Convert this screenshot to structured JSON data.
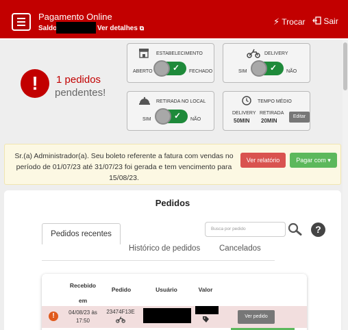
{
  "header": {
    "title": "Pagamento Online",
    "saldo_label": "Saldo",
    "ver_detalhes": "Ver detalhes",
    "trocar": "Trocar",
    "sair": "Sair"
  },
  "pending": {
    "count": "1 pedidos",
    "label": "pendentes!"
  },
  "cards": {
    "estabelecimento": {
      "title": "ESTABELECIMENTO",
      "left": "ABERTO",
      "right": "FECHADO"
    },
    "delivery": {
      "title": "DELIVERY",
      "left": "SIM",
      "right": "NÃO"
    },
    "retirada": {
      "title": "RETIRADA NO LOCAL",
      "left": "SIM",
      "right": "NÃO"
    },
    "tempo": {
      "title": "TEMPO MÉDIO",
      "delivery_label": "DELIVERY",
      "delivery_value": "50MIN",
      "retirada_label": "RETIRADA",
      "retirada_value": "20MIN",
      "editar": "Editar"
    }
  },
  "warning": {
    "text": "Sr.(a) Administrador(a). Seu boleto referente a fatura com vendas no período de 01/07/23 até 31/07/23 foi gerada e tem vencimento para 15/08/23.",
    "btn_relatorio": "Ver relatório",
    "btn_pagar": "Pagar com ▾"
  },
  "pedidos": {
    "title": "Pedidos",
    "tabs": [
      "Pedidos recentes",
      "Histórico de pedidos",
      "Cancelados"
    ],
    "search_placeholder": "Busca por pedido",
    "columns": [
      "Recebido em",
      "Pedido",
      "Usuário",
      "Valor"
    ],
    "rows": [
      {
        "recebido": "04/08/23 às 17:50",
        "pedido": "23474F13E",
        "action": "Ver pedido"
      }
    ]
  },
  "colors": {
    "brand_red": "#c20000",
    "toggle_green": "#1e8a3a",
    "danger": "#d9534f",
    "success": "#5cb85c"
  }
}
